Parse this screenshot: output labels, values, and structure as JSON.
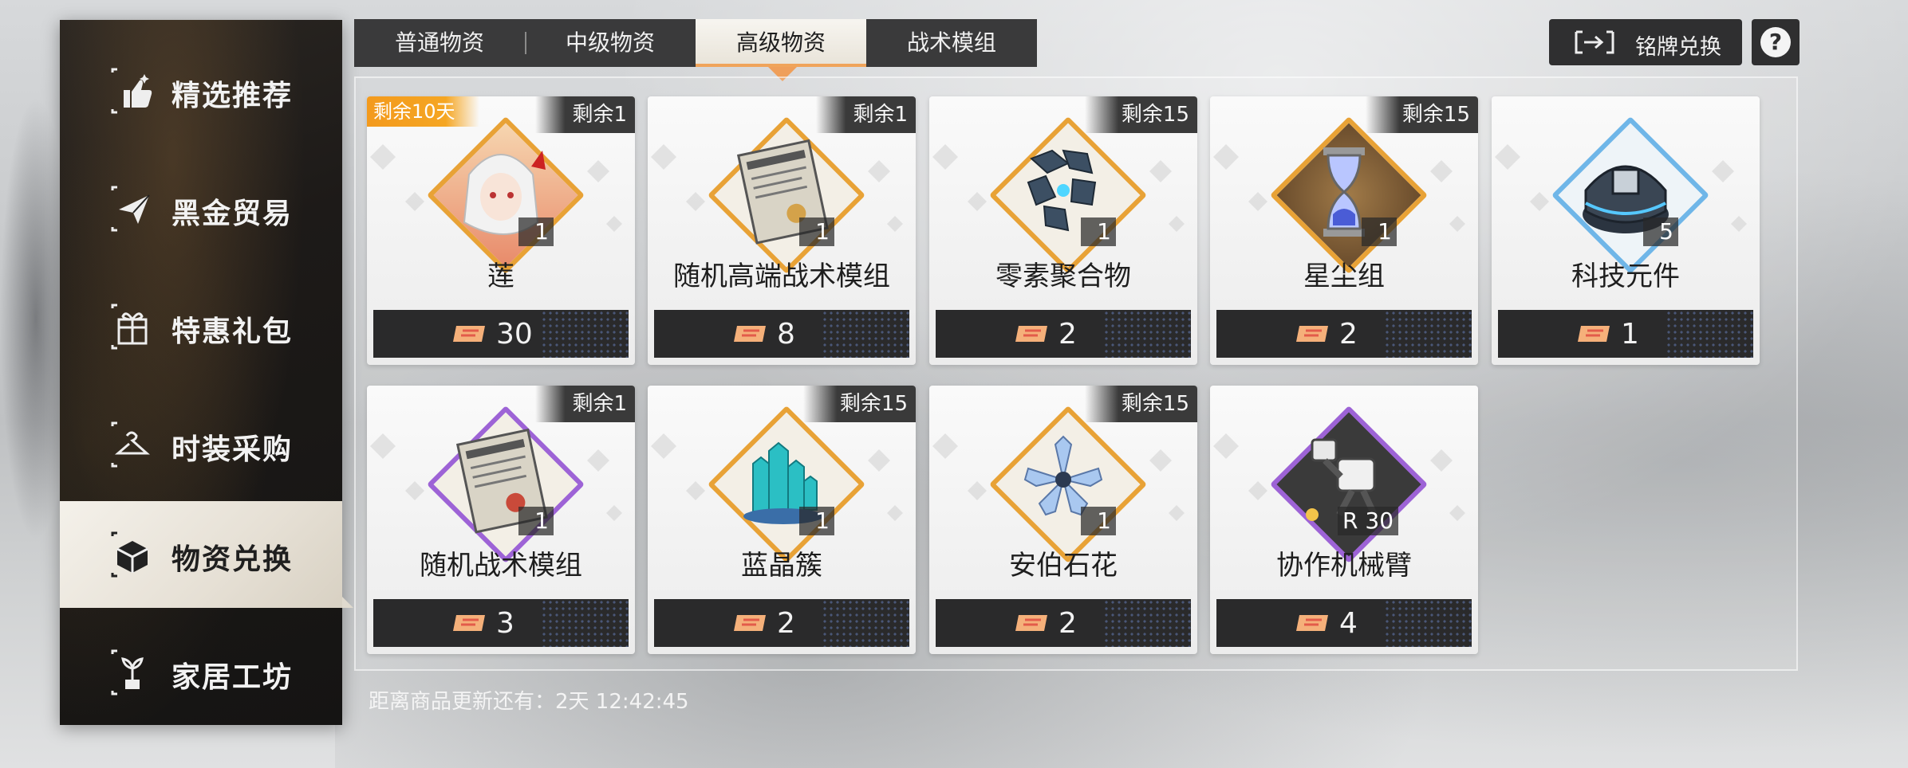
{
  "sidebar": {
    "items": [
      {
        "label": "精选推荐",
        "icon": "thumbs-up-icon"
      },
      {
        "label": "黑金贸易",
        "icon": "paper-plane-icon"
      },
      {
        "label": "特惠礼包",
        "icon": "gift-box-icon"
      },
      {
        "label": "时装采购",
        "icon": "hanger-icon"
      },
      {
        "label": "物资兑换",
        "icon": "supply-box-icon"
      },
      {
        "label": "家居工坊",
        "icon": "plant-icon"
      }
    ],
    "active_index": 4
  },
  "tabs": [
    {
      "label": "普通物资"
    },
    {
      "label": "中级物资"
    },
    {
      "label": "高级物资"
    },
    {
      "label": "战术模组"
    }
  ],
  "active_tab": 2,
  "top_right": {
    "exchange_label": "铭牌兑换",
    "exchange_icon": "nameplate-exchange-icon",
    "help_label": "?"
  },
  "items": [
    {
      "name": "莲",
      "remaining": "剩余1",
      "days_left": "剩余10天",
      "qty": "1",
      "price": "30",
      "frame_color": "#e8a236",
      "art": "character-portrait"
    },
    {
      "name": "随机高端战术模组",
      "remaining": "剩余1",
      "qty": "1",
      "price": "8",
      "frame_color": "#e8a236",
      "art": "module-document"
    },
    {
      "name": "零素聚合物",
      "remaining": "剩余15",
      "qty": "1",
      "price": "2",
      "frame_color": "#e8a236",
      "art": "polymer-cubes"
    },
    {
      "name": "星尘组",
      "remaining": "剩余15",
      "qty": "1",
      "price": "2",
      "frame_color": "#e8a236",
      "art": "hourglass"
    },
    {
      "name": "科技元件",
      "remaining": "",
      "qty": "5",
      "price": "1",
      "frame_color": "#e8a236",
      "art": "tech-component"
    },
    {
      "name": "随机战术模组",
      "remaining": "剩余1",
      "qty": "1",
      "price": "3",
      "frame_color": "#9d63d6",
      "art": "module-document"
    },
    {
      "name": "蓝晶簇",
      "remaining": "剩余15",
      "qty": "1",
      "price": "2",
      "frame_color": "#e8a236",
      "art": "crystal-cluster"
    },
    {
      "name": "安伯石花",
      "remaining": "剩余15",
      "qty": "1",
      "price": "2",
      "frame_color": "#e8a236",
      "art": "crystal-flower"
    },
    {
      "name": "协作机械臂",
      "remaining": "",
      "qty": "30",
      "qty_prefix": "R",
      "price": "4",
      "frame_color": "#9d63d6",
      "art": "robot-arm"
    }
  ],
  "currency_icon": "ticket-icon",
  "refresh_text": "距离商品更新还有：2天 12:42:45"
}
